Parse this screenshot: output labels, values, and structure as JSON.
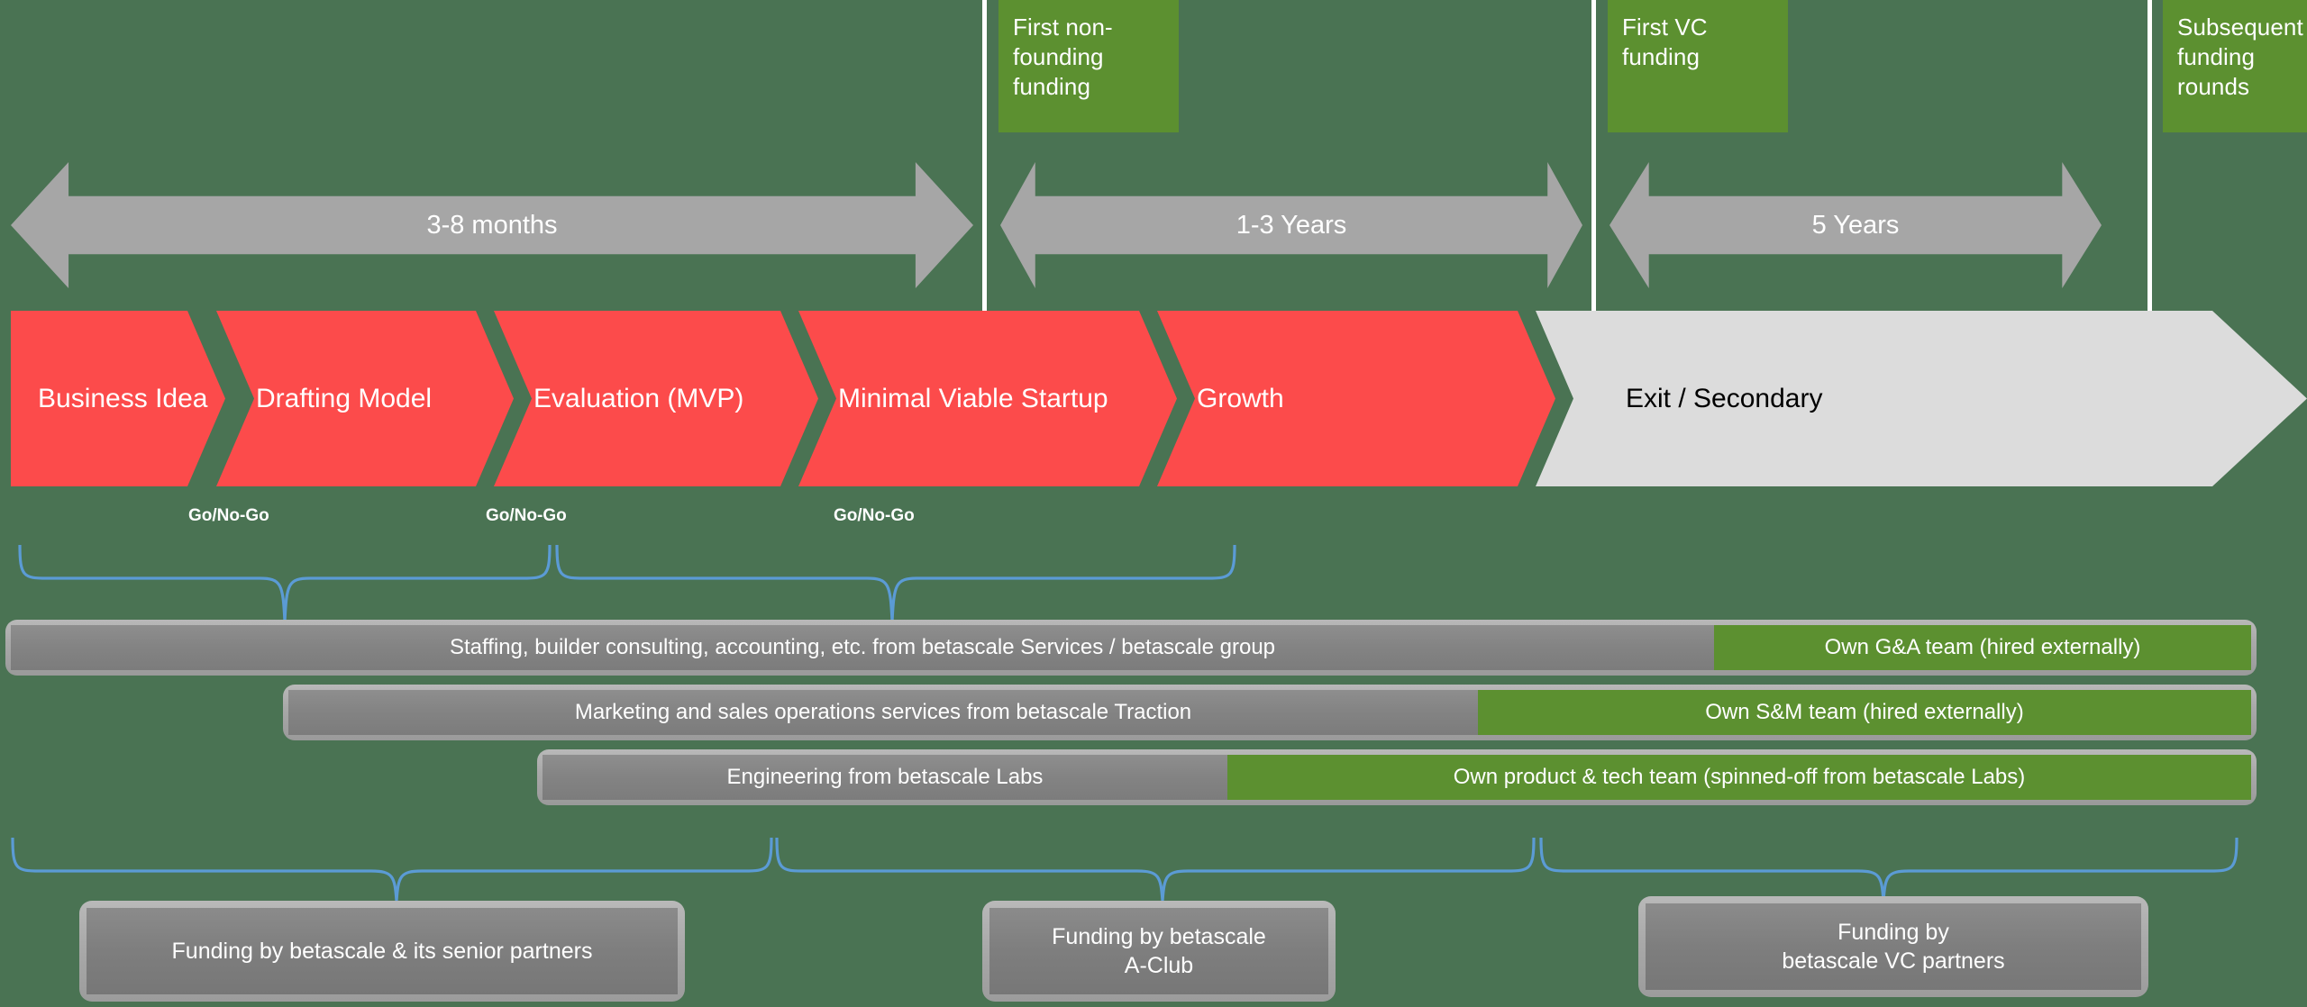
{
  "colors": {
    "background": "#4a7353",
    "milestone_green": "#5c9030",
    "stage_red": "#fc4b4b",
    "exit_grey": "#dcdcdc",
    "arrow_grey": "#a6a6a6",
    "bar_grey": "#838383",
    "brace_blue": "#5b9bd5",
    "separator_white": "#ffffff"
  },
  "milestones": [
    {
      "id": "first-non-founding-funding",
      "label": "First non-founding funding"
    },
    {
      "id": "first-vc-funding",
      "label": "First VC funding"
    },
    {
      "id": "subsequent-funding-rounds",
      "label": "Subsequent funding rounds"
    }
  ],
  "durations": [
    {
      "id": "duration-1",
      "label": "3-8 months"
    },
    {
      "id": "duration-2",
      "label": "1-3 Years"
    },
    {
      "id": "duration-3",
      "label": "5 Years"
    }
  ],
  "stages": [
    {
      "id": "business-idea",
      "label": "Business Idea"
    },
    {
      "id": "drafting-model",
      "label": "Drafting Model"
    },
    {
      "id": "evaluation-mvp",
      "label": "Evaluation (MVP)"
    },
    {
      "id": "minimal-viable-startup",
      "label": "Minimal Viable Startup"
    },
    {
      "id": "growth",
      "label": "Growth"
    },
    {
      "id": "exit-secondary",
      "label": "Exit / Secondary"
    }
  ],
  "gates": [
    {
      "id": "gate-1",
      "label": "Go/No-Go"
    },
    {
      "id": "gate-2",
      "label": "Go/No-Go"
    },
    {
      "id": "gate-3",
      "label": "Go/No-Go"
    }
  ],
  "service_rows": [
    {
      "id": "row-ga",
      "provided": "Staffing, builder consulting, accounting, etc. from betascale Services / betascale group",
      "own": "Own G&A team (hired externally)"
    },
    {
      "id": "row-sm",
      "provided": "Marketing and sales operations services from betascale Traction",
      "own": "Own S&M team (hired externally)"
    },
    {
      "id": "row-tech",
      "provided": "Engineering from betascale Labs",
      "own": "Own product & tech team (spinned-off from betascale Labs)"
    }
  ],
  "funding_boxes": [
    {
      "id": "funding-senior-partners",
      "label": "Funding by betascale & its senior partners"
    },
    {
      "id": "funding-a-club",
      "label": "Funding by betascale\nA-Club"
    },
    {
      "id": "funding-vc-partners",
      "label": "Funding by\nbetascale VC partners"
    }
  ]
}
